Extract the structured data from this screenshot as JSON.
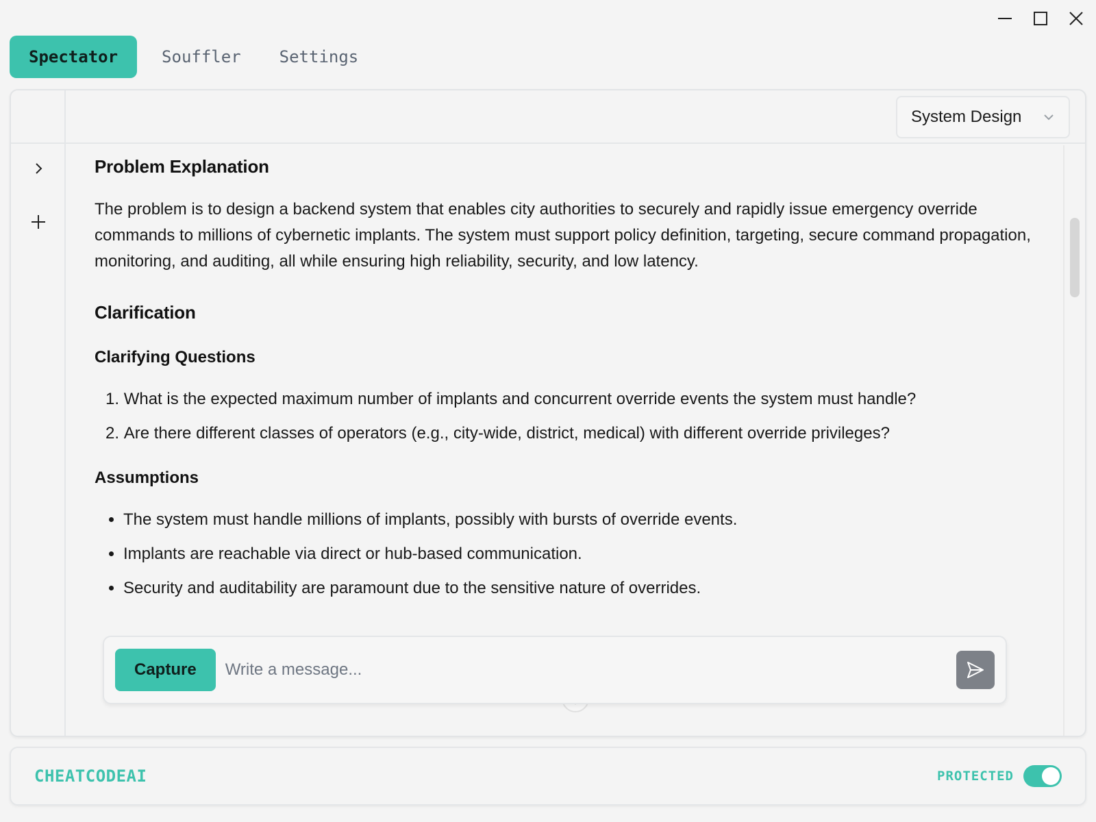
{
  "tabs": [
    {
      "label": "Spectator",
      "active": true
    },
    {
      "label": "Souffler",
      "active": false
    },
    {
      "label": "Settings",
      "active": false
    }
  ],
  "topbar": {
    "select_value": "System Design"
  },
  "content": {
    "problem_heading": "Problem Explanation",
    "problem_text": "The problem is to design a backend system that enables city authorities to securely and rapidly issue emergency override commands to millions of cybernetic implants. The system must support policy definition, targeting, secure command propagation, monitoring, and auditing, all while ensuring high reliability, security, and low latency.",
    "clarification_heading": "Clarification",
    "clarifying_questions_heading": "Clarifying Questions",
    "questions": [
      "What is the expected maximum number of implants and concurrent override events the system must handle?",
      "Are there different classes of operators (e.g., city-wide, district, medical) with different override privileges?"
    ],
    "assumptions_heading": "Assumptions",
    "assumptions": [
      "The system must handle millions of implants, possibly with bursts of override events.",
      "Implants are reachable via direct or hub-based communication.",
      "Security and auditability are paramount due to the sensitive nature of overrides."
    ]
  },
  "composer": {
    "capture_label": "Capture",
    "placeholder": "Write a message..."
  },
  "footer": {
    "brand": "CHEATCODEAI",
    "protected_label": "PROTECTED",
    "protected_on": true
  },
  "colors": {
    "accent": "#3dc2ad",
    "send_button": "#7d8188"
  }
}
